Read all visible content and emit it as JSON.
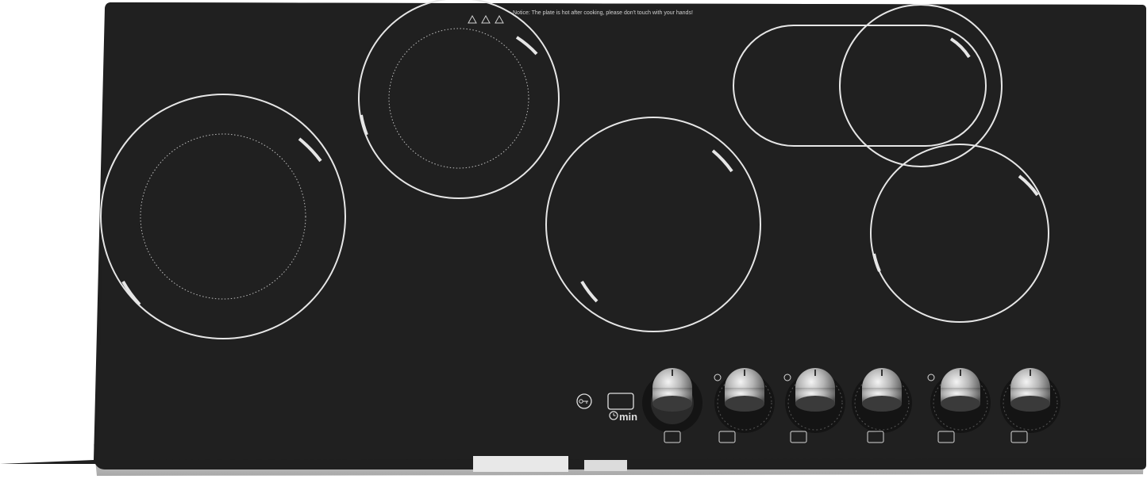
{
  "warning": {
    "notice": "Notice: The plate is hot after cooking, please don't touch with your hands!"
  },
  "controls": {
    "lock_icon": "key-lock-icon",
    "timer_icon": "timer-display-icon",
    "timer_unit": "min",
    "knob_count": 6
  },
  "colors": {
    "glass": "#1f1f1f",
    "zone_ring": "#e6e6e6",
    "frame": "#c4c4c4"
  }
}
